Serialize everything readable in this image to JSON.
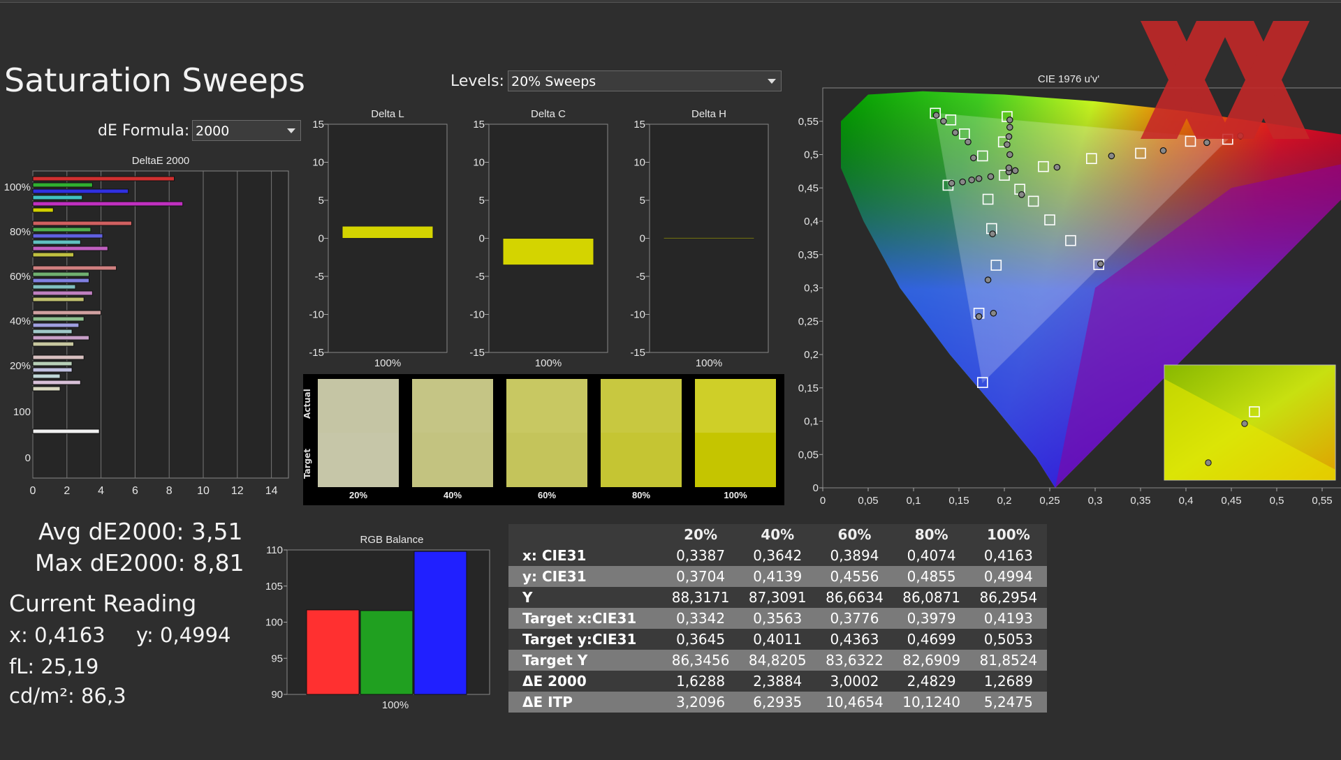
{
  "title": "Saturation Sweeps",
  "levels_label": "Levels:",
  "levels_value": "20% Sweeps",
  "formula_label": "dE Formula:",
  "formula_value": "2000",
  "colors": {
    "bg": "#2e2e2e",
    "panel": "#242424",
    "accent": "#d4d400",
    "red": "#ff3030",
    "green": "#20a020",
    "blue": "#2020ff"
  },
  "stats": {
    "avg": "Avg dE2000: 3,51",
    "max": "Max dE2000: 8,81",
    "current_reading": "Current Reading",
    "x": "x: 0,4163",
    "y": "y: 0,4994",
    "fl": "fL: 25,19",
    "cdm": "cd/m²: 86,3"
  },
  "chart_data": [
    {
      "type": "bar",
      "title": "DeltaE 2000",
      "orientation": "horizontal",
      "xlim": [
        0,
        15
      ],
      "xticks": [
        "0",
        "2",
        "4",
        "6",
        "8",
        "10",
        "12",
        "14"
      ],
      "yticks": [
        "100%",
        "80%",
        "60%",
        "40%",
        "20%",
        "100",
        "0"
      ],
      "groups": [
        {
          "label": "100%",
          "values": [
            8.3,
            3.5,
            5.6,
            2.9,
            8.8,
            1.2
          ],
          "colors": [
            "#d03030",
            "#30b030",
            "#3030e0",
            "#40c0c0",
            "#c030c0",
            "#d0d000"
          ]
        },
        {
          "label": "80%",
          "values": [
            5.8,
            3.4,
            4.1,
            2.8,
            4.4,
            2.4
          ],
          "colors": [
            "#d06060",
            "#50b050",
            "#6060e0",
            "#60c0c0",
            "#c060c0",
            "#c0c040"
          ]
        },
        {
          "label": "60%",
          "values": [
            4.9,
            3.3,
            3.3,
            2.5,
            3.5,
            3.0
          ],
          "colors": [
            "#d08080",
            "#70b070",
            "#8080e0",
            "#80c0c0",
            "#c080c0",
            "#c0c070"
          ]
        },
        {
          "label": "40%",
          "values": [
            4.0,
            3.0,
            2.7,
            2.3,
            3.3,
            2.4
          ],
          "colors": [
            "#d0a0a0",
            "#90c090",
            "#a0a0e0",
            "#a0c8c8",
            "#c8a0c8",
            "#c8c8a0"
          ]
        },
        {
          "label": "20%",
          "values": [
            3.0,
            2.3,
            2.3,
            1.6,
            2.8,
            1.6
          ],
          "colors": [
            "#d8c0c0",
            "#b8d0b8",
            "#c0c0e0",
            "#c0d8d8",
            "#d8c0d8",
            "#d8d8c0"
          ]
        },
        {
          "label": "100",
          "values": [
            3.9
          ],
          "colors": [
            "#f0f0f0"
          ]
        }
      ]
    },
    {
      "type": "bar",
      "title": "Delta L",
      "categories": [
        "100%"
      ],
      "values": [
        1.6
      ],
      "ylim": [
        -15,
        15
      ],
      "yticks": [
        "15",
        "10",
        "5",
        "0",
        "-5",
        "-10",
        "-15"
      ]
    },
    {
      "type": "bar",
      "title": "Delta C",
      "categories": [
        "100%"
      ],
      "values": [
        -3.5
      ],
      "ylim": [
        -15,
        15
      ],
      "yticks": [
        "15",
        "10",
        "5",
        "0",
        "-5",
        "-10",
        "-15"
      ]
    },
    {
      "type": "bar",
      "title": "Delta H",
      "categories": [
        "100%"
      ],
      "values": [
        0.1
      ],
      "ylim": [
        -15,
        15
      ],
      "yticks": [
        "15",
        "10",
        "5",
        "0",
        "-5",
        "-10",
        "-15"
      ]
    },
    {
      "type": "bar",
      "title": "RGB Balance",
      "categories": [
        "100%"
      ],
      "series": [
        {
          "values": [
            101.7
          ]
        },
        {
          "values": [
            101.6
          ]
        },
        {
          "values": [
            109.8
          ]
        }
      ],
      "series_colors": [
        "#ff3030",
        "#20a020",
        "#2020ff"
      ],
      "ylim": [
        90,
        110
      ],
      "yticks": [
        "110",
        "105",
        "100",
        "95",
        "90"
      ]
    },
    {
      "type": "scatter",
      "title": "CIE 1976 u'v'",
      "xlim": [
        0,
        0.6
      ],
      "ylim": [
        0,
        0.6
      ],
      "xticks": [
        "0",
        "0,05",
        "0,1",
        "0,15",
        "0,2",
        "0,25",
        "0,3",
        "0,35",
        "0,4",
        "0,45",
        "0,5",
        "0,55"
      ],
      "yticks": [
        "0",
        "0,05",
        "0,1",
        "0,15",
        "0,2",
        "0,25",
        "0,3",
        "0,35",
        "0,4",
        "0,45",
        "0,5",
        "0,55"
      ],
      "targets": [
        [
          0.2,
          0.469
        ],
        [
          0.124,
          0.562
        ],
        [
          0.138,
          0.454
        ],
        [
          0.176,
          0.158
        ],
        [
          0.446,
          0.523
        ],
        [
          0.203,
          0.557
        ],
        [
          0.304,
          0.335
        ],
        [
          0.405,
          0.52
        ],
        [
          0.35,
          0.502
        ],
        [
          0.296,
          0.494
        ],
        [
          0.243,
          0.482
        ],
        [
          0.186,
          0.389
        ],
        [
          0.191,
          0.334
        ],
        [
          0.172,
          0.262
        ],
        [
          0.182,
          0.433
        ],
        [
          0.199,
          0.519
        ],
        [
          0.141,
          0.552
        ],
        [
          0.156,
          0.531
        ],
        [
          0.176,
          0.498
        ],
        [
          0.217,
          0.448
        ],
        [
          0.232,
          0.43
        ],
        [
          0.25,
          0.402
        ],
        [
          0.273,
          0.371
        ]
      ],
      "measured": [
        [
          0.205,
          0.474
        ],
        [
          0.125,
          0.559
        ],
        [
          0.142,
          0.457
        ],
        [
          0.187,
          0.381
        ],
        [
          0.182,
          0.312
        ],
        [
          0.188,
          0.262
        ],
        [
          0.172,
          0.257
        ],
        [
          0.258,
          0.481
        ],
        [
          0.318,
          0.498
        ],
        [
          0.375,
          0.506
        ],
        [
          0.423,
          0.518
        ],
        [
          0.46,
          0.528
        ],
        [
          0.212,
          0.476
        ],
        [
          0.205,
          0.48
        ],
        [
          0.206,
          0.5
        ],
        [
          0.203,
          0.515
        ],
        [
          0.205,
          0.527
        ],
        [
          0.206,
          0.541
        ],
        [
          0.206,
          0.552
        ],
        [
          0.133,
          0.55
        ],
        [
          0.146,
          0.533
        ],
        [
          0.16,
          0.519
        ],
        [
          0.166,
          0.495
        ],
        [
          0.154,
          0.459
        ],
        [
          0.164,
          0.462
        ],
        [
          0.172,
          0.464
        ],
        [
          0.185,
          0.467
        ],
        [
          0.219,
          0.44
        ],
        [
          0.306,
          0.336
        ]
      ]
    }
  ],
  "swatches": {
    "actual_label": "Actual",
    "target_label": "Target",
    "items": [
      {
        "label": "20%",
        "actual": "#c5c5a4",
        "target": "#c6c6a8"
      },
      {
        "label": "40%",
        "actual": "#c5c585",
        "target": "#c3c380"
      },
      {
        "label": "60%",
        "actual": "#c8c862",
        "target": "#c4c45b"
      },
      {
        "label": "80%",
        "actual": "#c8c840",
        "target": "#c5c533"
      },
      {
        "label": "100%",
        "actual": "#cfcf28",
        "target": "#c5c500"
      }
    ]
  },
  "table": {
    "columns": [
      "20%",
      "40%",
      "60%",
      "80%",
      "100%"
    ],
    "rows": [
      {
        "label": "x: CIE31",
        "values": [
          "0,3387",
          "0,3642",
          "0,3894",
          "0,4074",
          "0,4163"
        ]
      },
      {
        "label": "y: CIE31",
        "values": [
          "0,3704",
          "0,4139",
          "0,4556",
          "0,4855",
          "0,4994"
        ]
      },
      {
        "label": "Y",
        "values": [
          "88,3171",
          "87,3091",
          "86,6634",
          "86,0871",
          "86,2954"
        ]
      },
      {
        "label": "Target x:CIE31",
        "values": [
          "0,3342",
          "0,3563",
          "0,3776",
          "0,3979",
          "0,4193"
        ]
      },
      {
        "label": "Target y:CIE31",
        "values": [
          "0,3645",
          "0,4011",
          "0,4363",
          "0,4699",
          "0,5053"
        ]
      },
      {
        "label": "Target Y",
        "values": [
          "86,3456",
          "84,8205",
          "83,6322",
          "82,6909",
          "81,8524"
        ]
      },
      {
        "label": "ΔE 2000",
        "values": [
          "1,6288",
          "2,3884",
          "3,0002",
          "2,4829",
          "1,2689"
        ]
      },
      {
        "label": "ΔE ITP",
        "values": [
          "3,2096",
          "6,2935",
          "10,4654",
          "10,1240",
          "5,2475"
        ]
      }
    ]
  }
}
